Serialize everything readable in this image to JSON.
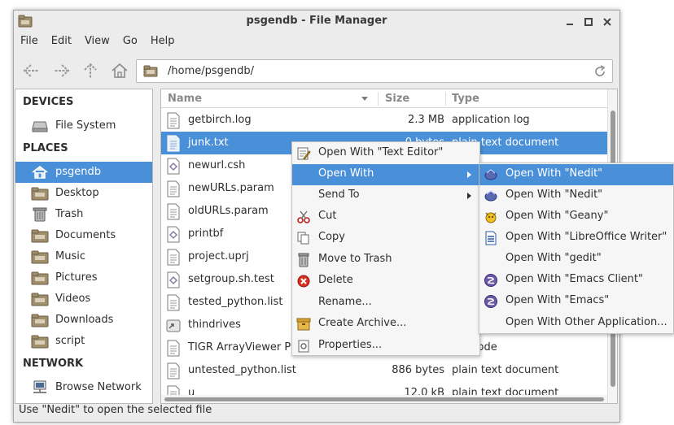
{
  "window": {
    "title": "psgendb - File Manager"
  },
  "menubar": [
    "File",
    "Edit",
    "View",
    "Go",
    "Help"
  ],
  "location": {
    "path": "/home/psgendb/"
  },
  "sidebar": {
    "devices_heading": "DEVICES",
    "devices": [
      {
        "label": "File System",
        "icon": "drive-icon"
      }
    ],
    "places_heading": "PLACES",
    "places": [
      {
        "label": "psgendb",
        "icon": "home-icon",
        "selected": true
      },
      {
        "label": "Desktop",
        "icon": "folder-icon"
      },
      {
        "label": "Trash",
        "icon": "trash-icon"
      },
      {
        "label": "Documents",
        "icon": "folder-icon"
      },
      {
        "label": "Music",
        "icon": "folder-icon"
      },
      {
        "label": "Pictures",
        "icon": "folder-icon"
      },
      {
        "label": "Videos",
        "icon": "folder-icon"
      },
      {
        "label": "Downloads",
        "icon": "folder-icon"
      },
      {
        "label": "script",
        "icon": "folder-icon"
      }
    ],
    "network_heading": "NETWORK",
    "network": [
      {
        "label": "Browse Network",
        "icon": "network-icon"
      }
    ]
  },
  "filelist": {
    "columns": {
      "name": "Name",
      "size": "Size",
      "type": "Type"
    },
    "rows": [
      {
        "name": "getbirch.log",
        "size": "2.3 MB",
        "type": "application log",
        "icon": "text-file-icon"
      },
      {
        "name": "junk.txt",
        "size": "0 bytes",
        "type": "plain text document",
        "icon": "text-file-icon",
        "selected": true
      },
      {
        "name": "newurl.csh",
        "size": "",
        "type": "",
        "icon": "script-file-icon"
      },
      {
        "name": "newURLs.param",
        "size": "",
        "type": "",
        "icon": "text-file-icon"
      },
      {
        "name": "oldURLs.param",
        "size": "",
        "type": "",
        "icon": "text-file-icon"
      },
      {
        "name": "printbf",
        "size": "",
        "type": "",
        "icon": "script-file-icon"
      },
      {
        "name": "project.uprj",
        "size": "",
        "type": "",
        "icon": "text-file-icon"
      },
      {
        "name": "setgroup.sh.test",
        "size": "",
        "type": "",
        "icon": "script-file-icon"
      },
      {
        "name": "tested_python.list",
        "size": "",
        "type": "",
        "icon": "text-file-icon"
      },
      {
        "name": "thindrives",
        "size": "",
        "type": "",
        "icon": "link-file-icon"
      },
      {
        "name": "TIGR ArrayViewer P",
        "size": "",
        "type": "rce code",
        "icon": "text-file-icon"
      },
      {
        "name": "untested_python.list",
        "size": "886 bytes",
        "type": "plain text document",
        "icon": "text-file-icon"
      },
      {
        "name": "u",
        "size": "12.0 kB",
        "type": "plain text document",
        "icon": "text-file-icon"
      }
    ]
  },
  "context_menu": [
    {
      "label": "Open With \"Text Editor\"",
      "icon": "text-editor-icon"
    },
    {
      "label": "Open With",
      "icon": "",
      "submenu": true,
      "highlighted": true
    },
    {
      "label": "Send To",
      "icon": "",
      "submenu": true
    },
    {
      "label": "Cut",
      "icon": "scissors-icon"
    },
    {
      "label": "Copy",
      "icon": "copy-icon"
    },
    {
      "label": "Move to Trash",
      "icon": "trash-icon"
    },
    {
      "label": "Delete",
      "icon": "delete-icon"
    },
    {
      "label": "Rename...",
      "icon": ""
    },
    {
      "label": "Create Archive...",
      "icon": "archive-icon"
    },
    {
      "label": "Properties...",
      "icon": "properties-icon"
    }
  ],
  "submenu": [
    {
      "label": "Open With \"Nedit\"",
      "icon": "nedit-icon",
      "highlighted": true
    },
    {
      "label": "Open With \"Nedit\"",
      "icon": "nedit-icon"
    },
    {
      "label": "Open With \"Geany\"",
      "icon": "geany-icon"
    },
    {
      "label": "Open With \"LibreOffice Writer\"",
      "icon": "writer-icon"
    },
    {
      "label": "Open With \"gedit\"",
      "icon": ""
    },
    {
      "label": "Open With \"Emacs Client\"",
      "icon": "emacs-icon"
    },
    {
      "label": "Open With \"Emacs\"",
      "icon": "emacs-icon"
    },
    {
      "label": "Open With Other Application...",
      "icon": ""
    }
  ],
  "statusbar": {
    "text": "Use \"Nedit\" to open the selected file"
  },
  "colors": {
    "selection": "#4a90d9",
    "window_bg": "#ececec"
  }
}
